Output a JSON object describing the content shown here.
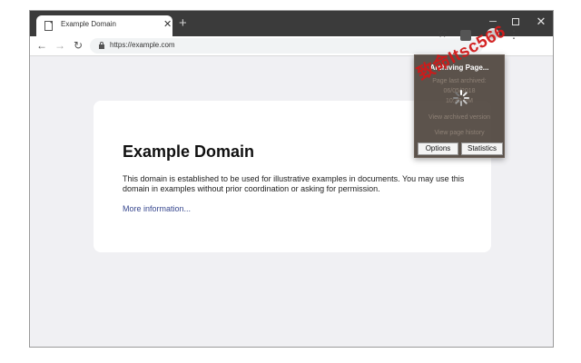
{
  "browser": {
    "tab": {
      "title": "Example Domain",
      "close_glyph": "✕"
    },
    "new_tab_glyph": "+",
    "window_controls": {
      "minimize": "─",
      "close": "✕"
    },
    "nav": {
      "back": "←",
      "forward": "→",
      "reload": "↻"
    },
    "url": "https://example.com",
    "bookmark_glyph": "☆",
    "menu_glyph": "⋮"
  },
  "page": {
    "title": "Example Domain",
    "body": "This domain is established to be used for illustrative examples in documents. You may use this domain in examples without prior coordination or asking for permission.",
    "link": "More information..."
  },
  "popup": {
    "title": "Archiving Page...",
    "info_line1": "Page last archived:",
    "info_line2": "06/05/2018",
    "info_line3": "10:30 PM",
    "link_archived": "View archived version",
    "link_history": "View page history",
    "options_label": "Options",
    "statistics_label": "Statistics"
  },
  "watermark": "致命Itsc566",
  "colors": {
    "titlebar": "#3b3b3b",
    "popup_bg": "#4a4039",
    "link": "#38488f",
    "watermark": "#d21a1a"
  }
}
